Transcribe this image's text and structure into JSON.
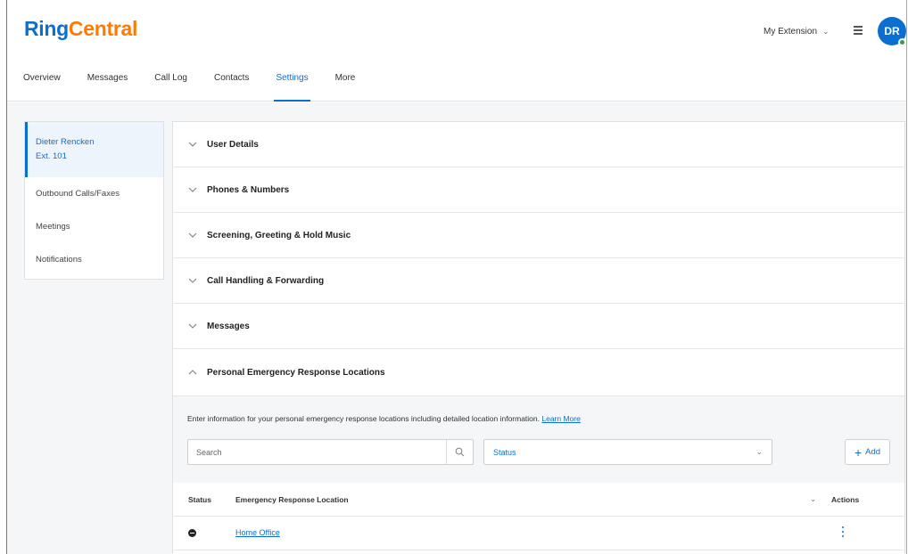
{
  "brand": {
    "part1": "Ring",
    "part2": "Central"
  },
  "header": {
    "extension_label": "My Extension",
    "avatar_initials": "DR"
  },
  "nav": {
    "tabs": [
      "Overview",
      "Messages",
      "Call Log",
      "Contacts",
      "Settings",
      "More"
    ],
    "active": "Settings"
  },
  "sidebar": {
    "user_name": "Dieter Rencken",
    "user_ext": "Ext. 101",
    "items": [
      "Outbound Calls/Faxes",
      "Meetings",
      "Notifications"
    ]
  },
  "sections": [
    "User Details",
    "Phones & Numbers",
    "Screening, Greeting & Hold Music",
    "Call Handling & Forwarding",
    "Messages",
    "Personal Emergency Response Locations"
  ],
  "erl": {
    "description": "Enter information for your personal emergency response locations including detailed location information.",
    "learn_more": "Learn More",
    "search_placeholder": "Search",
    "status_filter": "Status",
    "add_label": "Add",
    "columns": {
      "status": "Status",
      "location": "Emergency Response Location",
      "actions": "Actions"
    },
    "rows": [
      {
        "location": "Home Office"
      }
    ]
  },
  "colors": {
    "accent": "#0b6fd1",
    "brand_orange": "#ff7a00",
    "online": "#29a343"
  }
}
